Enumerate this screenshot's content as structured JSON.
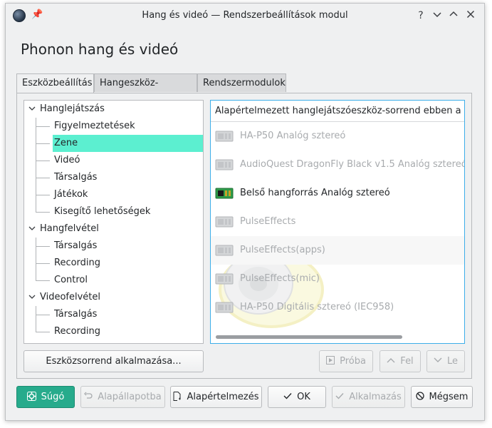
{
  "window": {
    "title": "Hang és videó — Rendszerbeállítások modul",
    "buttons": {
      "help": "?",
      "minimize": "⌄",
      "maximize": "⌃",
      "close": "✕"
    }
  },
  "page": {
    "title": "Phonon hang és videó"
  },
  "tabs": [
    {
      "label": "Eszközbeállítás",
      "active": true
    },
    {
      "label": "Hangeszköz-beállítás",
      "active": false
    },
    {
      "label": "Rendszermodulok",
      "active": false
    }
  ],
  "tree": {
    "groups": [
      {
        "label": "Hanglejátszás",
        "children": [
          "Figyelmeztetések",
          "Zene",
          "Videó",
          "Társalgás",
          "Játékok",
          "Kisegítő lehetőségek"
        ]
      },
      {
        "label": "Hangfelvétel",
        "children": [
          "Társalgás",
          "Recording",
          "Control"
        ]
      },
      {
        "label": "Videofelvétel",
        "children": [
          "Társalgás",
          "Recording"
        ]
      }
    ],
    "selected": "Zene"
  },
  "device_list": {
    "header": "Alapértelmezett hanglejátszóeszköz-sorrend ebben a kate",
    "devices": [
      {
        "label": "HA-P50 Analóg sztereó",
        "available": false
      },
      {
        "label": "AudioQuest DragonFly Black v1.5 Analóg sztereó",
        "available": false
      },
      {
        "label": "Belső hangforrás Analóg sztereó",
        "available": true
      },
      {
        "label": "PulseEffects",
        "available": false
      },
      {
        "label": "PulseEffects(apps)",
        "available": false
      },
      {
        "label": "PulseEffects(mic)",
        "available": false
      },
      {
        "label": "HA-P50 Digitális sztereó (IEC958)",
        "available": false
      }
    ]
  },
  "actions": {
    "apply_order": "Eszközsorrend alkalmazása...",
    "test": "Próba",
    "up": "Fel",
    "down": "Le"
  },
  "footer": {
    "help": "Súgó",
    "reset": "Alapállapotba",
    "defaults": "Alapértelmezés",
    "ok": "OK",
    "apply": "Alkalmazás",
    "cancel": "Mégsem"
  },
  "colors": {
    "selection": "#5cefd0",
    "focus_border": "#3daee9",
    "primary_button": "#27ab8c"
  }
}
